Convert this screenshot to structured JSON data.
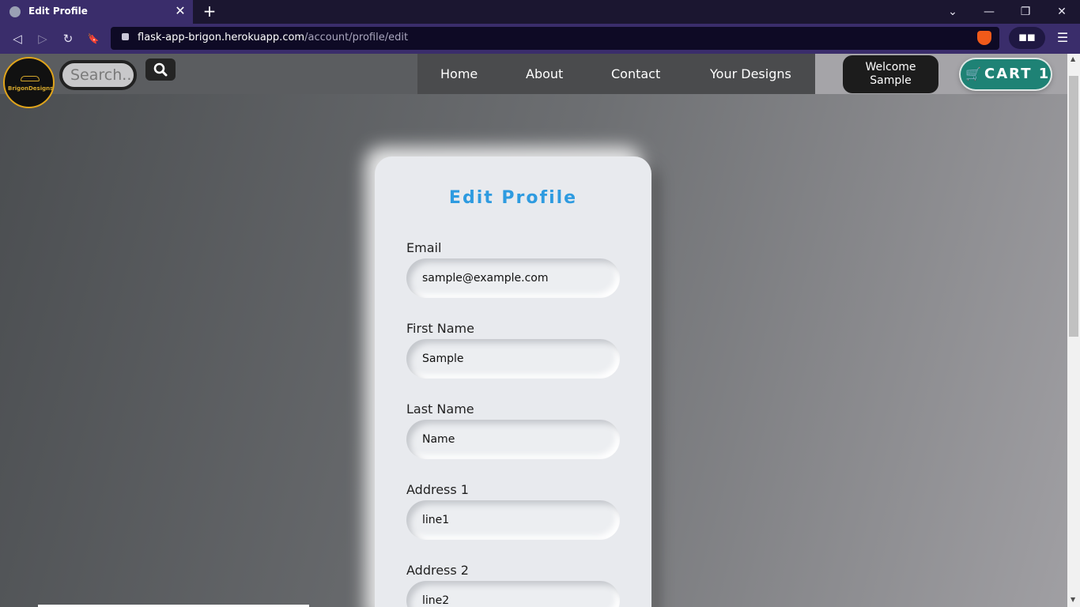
{
  "browser": {
    "tab_title": "Edit Profile",
    "tab_close": "✕",
    "new_tab": "+",
    "url_domain": "flask-app-brigon.herokuapp.com",
    "url_path": "/account/profile/edit",
    "win_controls": [
      "⌄",
      "—",
      "❐",
      "✕"
    ],
    "nav_icons": [
      "◁",
      "▷",
      "↻",
      "🔖"
    ],
    "ext_label": "◼◼",
    "menu_icon": "☰"
  },
  "header": {
    "logo_text": "BrigonDesigns",
    "search_placeholder": "Search...",
    "nav": [
      "Home",
      "About",
      "Contact",
      "Your Designs"
    ],
    "welcome_line1": "Welcome",
    "welcome_line2": "Sample",
    "cart_label": "CART 1",
    "cart_icon": "🛒"
  },
  "form": {
    "title": "Edit Profile",
    "fields": [
      {
        "label": "Email",
        "value": "sample@example.com"
      },
      {
        "label": "First Name",
        "value": "Sample"
      },
      {
        "label": "Last Name",
        "value": "Name"
      },
      {
        "label": "Address 1",
        "value": "line1"
      },
      {
        "label": "Address 2",
        "value": "line2"
      }
    ]
  },
  "colors": {
    "title_blue": "#2e9be0",
    "cart_green": "#1e8275",
    "chrome_purple": "#3a2d6b"
  }
}
